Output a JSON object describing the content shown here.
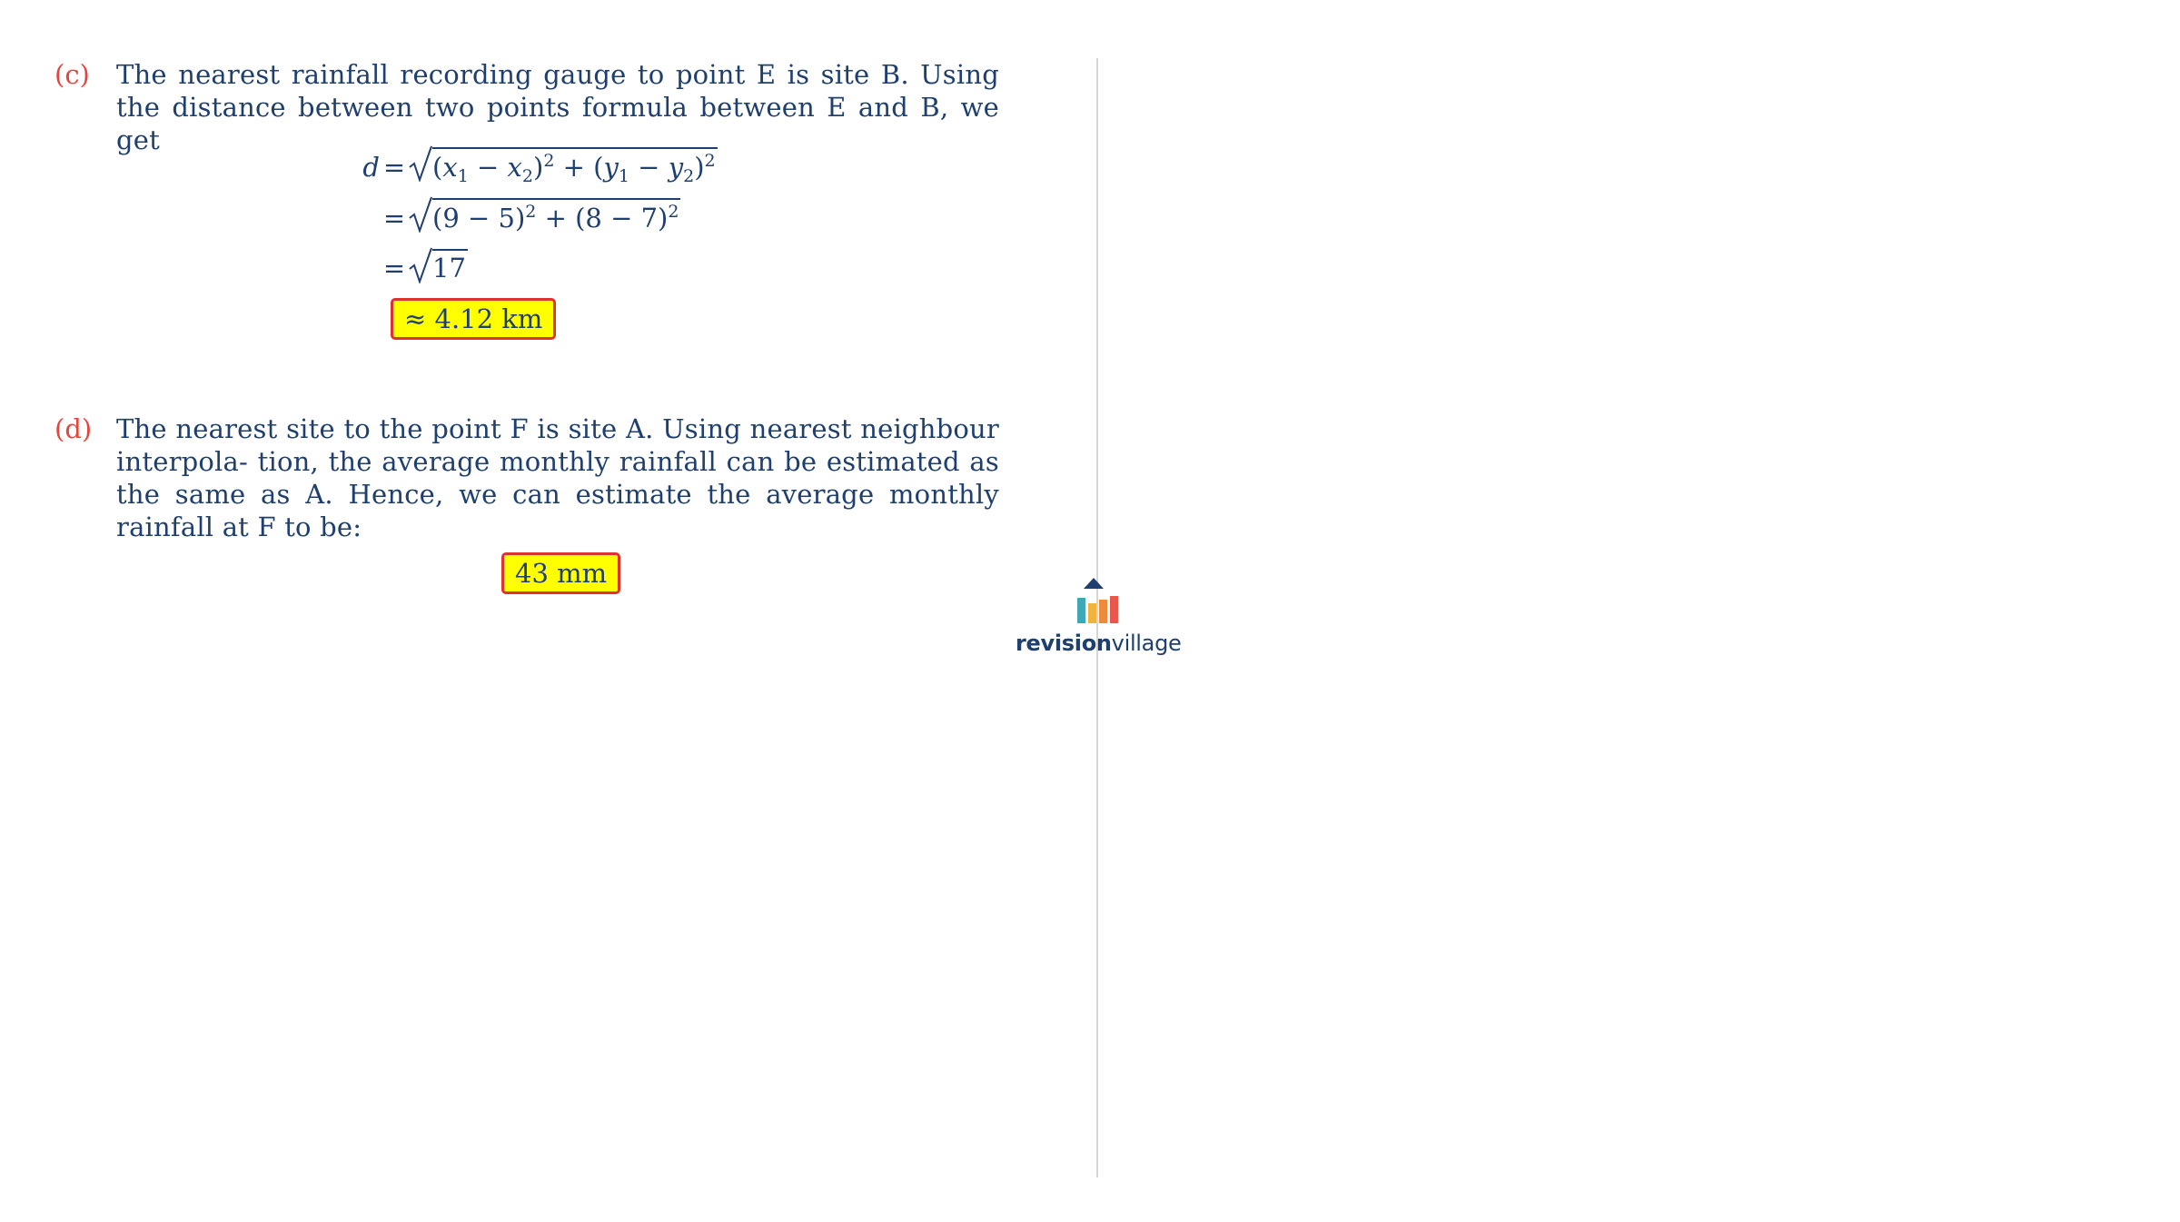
{
  "part_c": {
    "label": "(c)",
    "text": "The nearest rainfall recording gauge to point E is site B. Using the distance between two points formula between E and B, we get",
    "eq1_lhs": "d",
    "eq_sign": "=",
    "eq1_body": {
      "open": "(",
      "x1": "x",
      "s1": "1",
      "minus": " − ",
      "x2": "x",
      "s2": "2",
      "close_sq": ")",
      "pow": "2",
      "plus": " + (",
      "y1": "y",
      "s3": "1",
      "y2": "y",
      "s4": "2",
      "pow2": "2"
    },
    "eq2_body": "(9 − 5)",
    "eq2_pow1": "2",
    "eq2_mid": " + (8 − 7)",
    "eq2_pow2": "2",
    "eq3_body": "17",
    "answer": "≈ 4.12 km"
  },
  "part_d": {
    "label": "(d)",
    "text": "The nearest site to the point F is site A. Using nearest neighbour interpola- tion, the average monthly rainfall can be estimated as the same as A. Hence, we can estimate the average monthly rainfall at F to be:",
    "answer": "43 mm"
  },
  "logo": {
    "word_bold": "revision",
    "word_light": "village",
    "colors": {
      "navy": "#1f3f6e",
      "teal": "#3fa7b5",
      "yellow": "#f2b33d",
      "orange": "#ee8a3c",
      "red": "#e8574a"
    }
  },
  "colors": {
    "text": "#1f3f6e",
    "label": "#e2473f",
    "highlight": "#ffff00",
    "box_border": "#e0322c"
  }
}
